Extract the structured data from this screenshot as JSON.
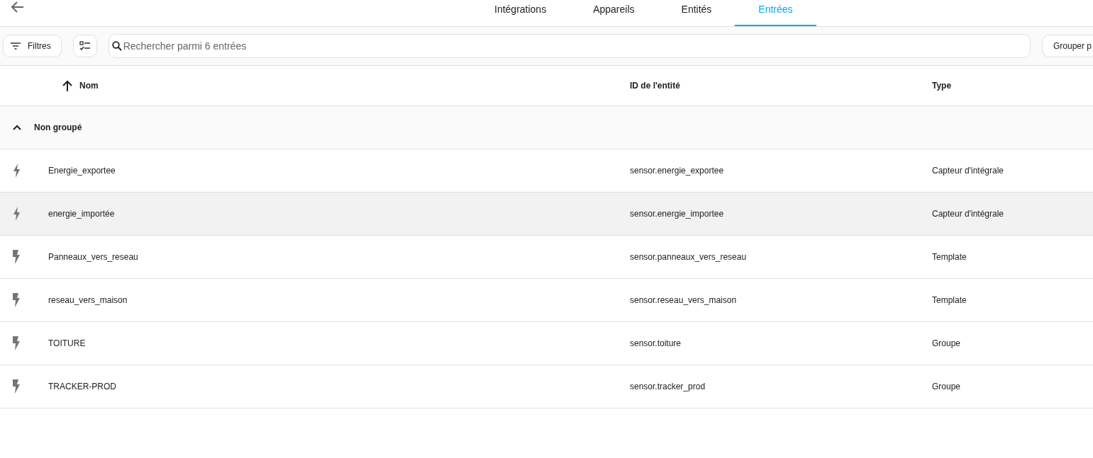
{
  "tabs": [
    {
      "label": "Intégrations",
      "selected": false
    },
    {
      "label": "Appareils",
      "selected": false
    },
    {
      "label": "Entités",
      "selected": false
    },
    {
      "label": "Entrées",
      "selected": true
    }
  ],
  "toolbar": {
    "filters_label": "Filtres",
    "search": {
      "placeholder": "Rechercher parmi 6 entrées"
    },
    "group_button_label": "Grouper p"
  },
  "table": {
    "columns": [
      "Nom",
      "ID de l'entité",
      "Type"
    ],
    "group": {
      "label": "Non groupé",
      "expanded": true
    },
    "rows": [
      {
        "kind": "thin",
        "name": "Energie_exportee",
        "entity_id": "sensor.energie_exportee",
        "type": "Capteur d'intégrale",
        "highlighted": false
      },
      {
        "kind": "thin",
        "name": "energie_importée",
        "entity_id": "sensor.energie_importee",
        "type": "Capteur d'intégrale",
        "highlighted": true
      },
      {
        "kind": "block",
        "name": "Panneaux_vers_reseau",
        "entity_id": "sensor.panneaux_vers_reseau",
        "type": "Template",
        "highlighted": false
      },
      {
        "kind": "block",
        "name": "reseau_vers_maison",
        "entity_id": "sensor.reseau_vers_maison",
        "type": "Template",
        "highlighted": false
      },
      {
        "kind": "block",
        "name": "TOITURE",
        "entity_id": "sensor.toiture",
        "type": "Groupe",
        "highlighted": false
      },
      {
        "kind": "block",
        "name": "TRACKER-PROD",
        "entity_id": "sensor.tracker_prod",
        "type": "Groupe",
        "highlighted": false
      }
    ]
  }
}
